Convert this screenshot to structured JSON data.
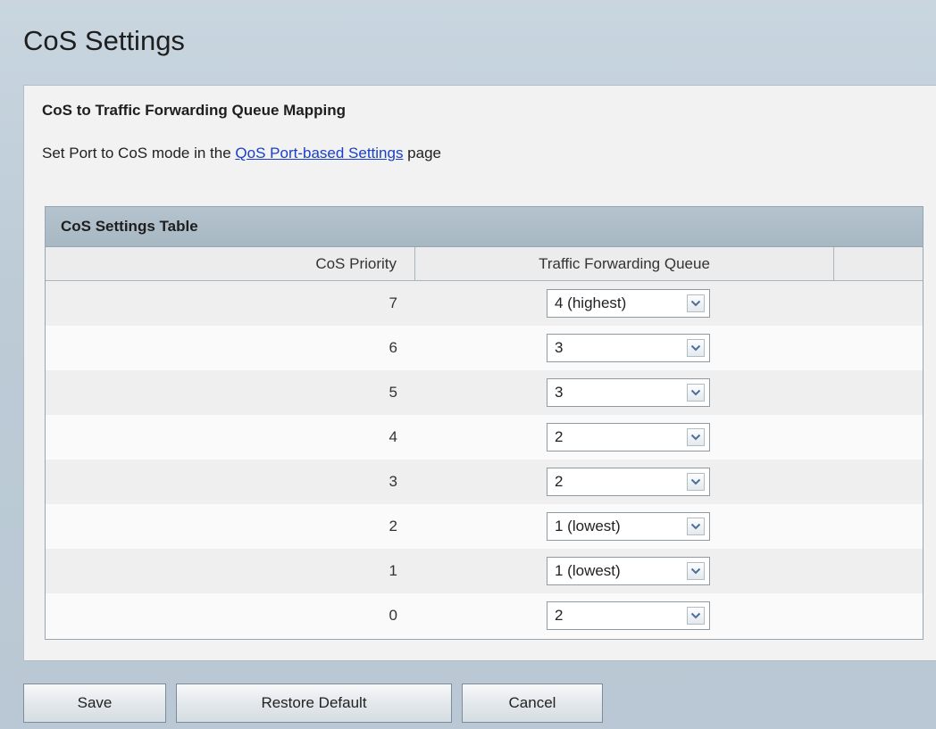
{
  "page": {
    "title": "CoS Settings"
  },
  "section": {
    "heading": "CoS to Traffic Forwarding Queue Mapping",
    "hint_prefix": "Set Port to CoS mode in the ",
    "hint_link": "QoS Port-based Settings",
    "hint_suffix": " page"
  },
  "table": {
    "caption": "CoS Settings Table",
    "columns": [
      "CoS Priority",
      "Traffic Forwarding Queue"
    ],
    "rows": [
      {
        "priority": "7",
        "queue": "4 (highest)"
      },
      {
        "priority": "6",
        "queue": "3"
      },
      {
        "priority": "5",
        "queue": "3"
      },
      {
        "priority": "4",
        "queue": "2"
      },
      {
        "priority": "3",
        "queue": "2"
      },
      {
        "priority": "2",
        "queue": "1 (lowest)"
      },
      {
        "priority": "1",
        "queue": "1 (lowest)"
      },
      {
        "priority": "0",
        "queue": "2"
      }
    ]
  },
  "buttons": {
    "save": "Save",
    "restore": "Restore Default",
    "cancel": "Cancel"
  },
  "icons": {
    "dropdown": "chevron-down-icon"
  },
  "colors": {
    "link": "#1a3fc7",
    "caption_bg": "#aebdc7"
  }
}
